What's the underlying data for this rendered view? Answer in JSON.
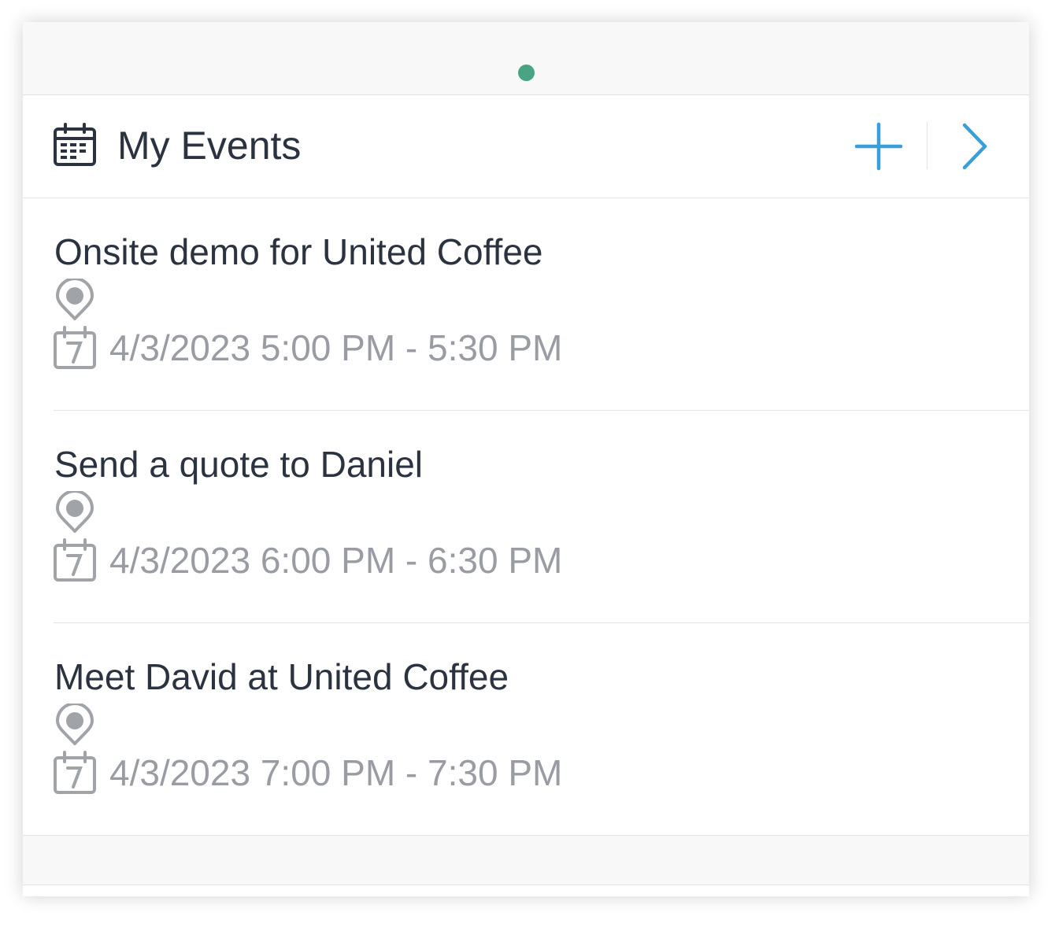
{
  "colors": {
    "status_dot": "#4aa383",
    "accent": "#3a9fd9",
    "title_text": "#2b3340",
    "meta_text": "#999da3",
    "icon_gray": "#a0a3a8"
  },
  "status": {
    "indicator_color": "#4aa383"
  },
  "header": {
    "icon": "calendar-icon",
    "title": "My Events",
    "actions": [
      {
        "icon": "plus-icon",
        "role": "add-event"
      },
      {
        "icon": "chevron-right-icon",
        "role": "open-all-events"
      }
    ]
  },
  "events": [
    {
      "title": "Onsite demo for United Coffee",
      "location_icon": "location-pin-icon",
      "date_icon": "calendar-7-icon",
      "time": "4/3/2023 5:00 PM - 5:30 PM"
    },
    {
      "title": "Send a quote to Daniel",
      "location_icon": "location-pin-icon",
      "date_icon": "calendar-7-icon",
      "time": "4/3/2023 6:00 PM - 6:30 PM"
    },
    {
      "title": "Meet David at United Coffee",
      "location_icon": "location-pin-icon",
      "date_icon": "calendar-7-icon",
      "time": "4/3/2023 7:00 PM - 7:30 PM"
    }
  ]
}
